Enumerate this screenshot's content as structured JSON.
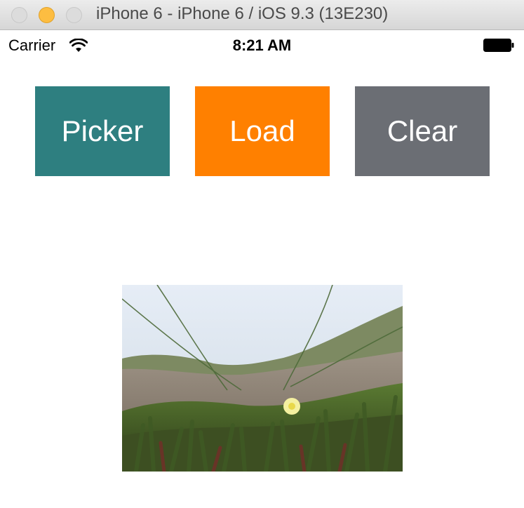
{
  "window": {
    "title": "iPhone 6 - iPhone 6 / iOS 9.3 (13E230)"
  },
  "status_bar": {
    "carrier": "Carrier",
    "time": "8:21 AM"
  },
  "buttons": [
    {
      "label": "Picker",
      "color": "#2e7f80"
    },
    {
      "label": "Load",
      "color": "#ff8000"
    },
    {
      "label": "Clear",
      "color": "#6b6e74"
    }
  ],
  "colors": {
    "titlebar": "#dcdcdc",
    "background": "#ffffff"
  }
}
